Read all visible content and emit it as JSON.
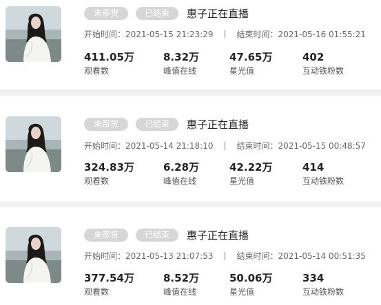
{
  "records": [
    {
      "tags": [
        "未带货",
        "已结束"
      ],
      "title": "惠子正在直播",
      "start_label": "开始时间：",
      "start_time": "2021-05-15 21:23:29",
      "end_label": "结束时间：",
      "end_time": "2021-05-16 01:55:21",
      "stats": [
        {
          "value": "411.05万",
          "label": "观看数"
        },
        {
          "value": "8.32万",
          "label": "峰值在线"
        },
        {
          "value": "47.65万",
          "label": "星光值"
        },
        {
          "value": "402",
          "label": "互动铁粉数"
        }
      ]
    },
    {
      "tags": [
        "未带货",
        "已结束"
      ],
      "title": "惠子正在直播",
      "start_label": "开始时间：",
      "start_time": "2021-05-14 21:18:10",
      "end_label": "结束时间：",
      "end_time": "2021-05-15 00:48:57",
      "stats": [
        {
          "value": "324.83万",
          "label": "观看数"
        },
        {
          "value": "6.28万",
          "label": "峰值在线"
        },
        {
          "value": "42.22万",
          "label": "星光值"
        },
        {
          "value": "414",
          "label": "互动铁粉数"
        }
      ]
    },
    {
      "tags": [
        "未带货",
        "已结束"
      ],
      "title": "惠子正在直播",
      "start_label": "开始时间：",
      "start_time": "2021-05-13 21:07:53",
      "end_label": "结束时间：",
      "end_time": "2021-05-14 00:51:35",
      "stats": [
        {
          "value": "377.54万",
          "label": "观看数"
        },
        {
          "value": "8.52万",
          "label": "峰值在线"
        },
        {
          "value": "50.06万",
          "label": "星光值"
        },
        {
          "value": "334",
          "label": "互动铁粉数"
        }
      ]
    }
  ]
}
